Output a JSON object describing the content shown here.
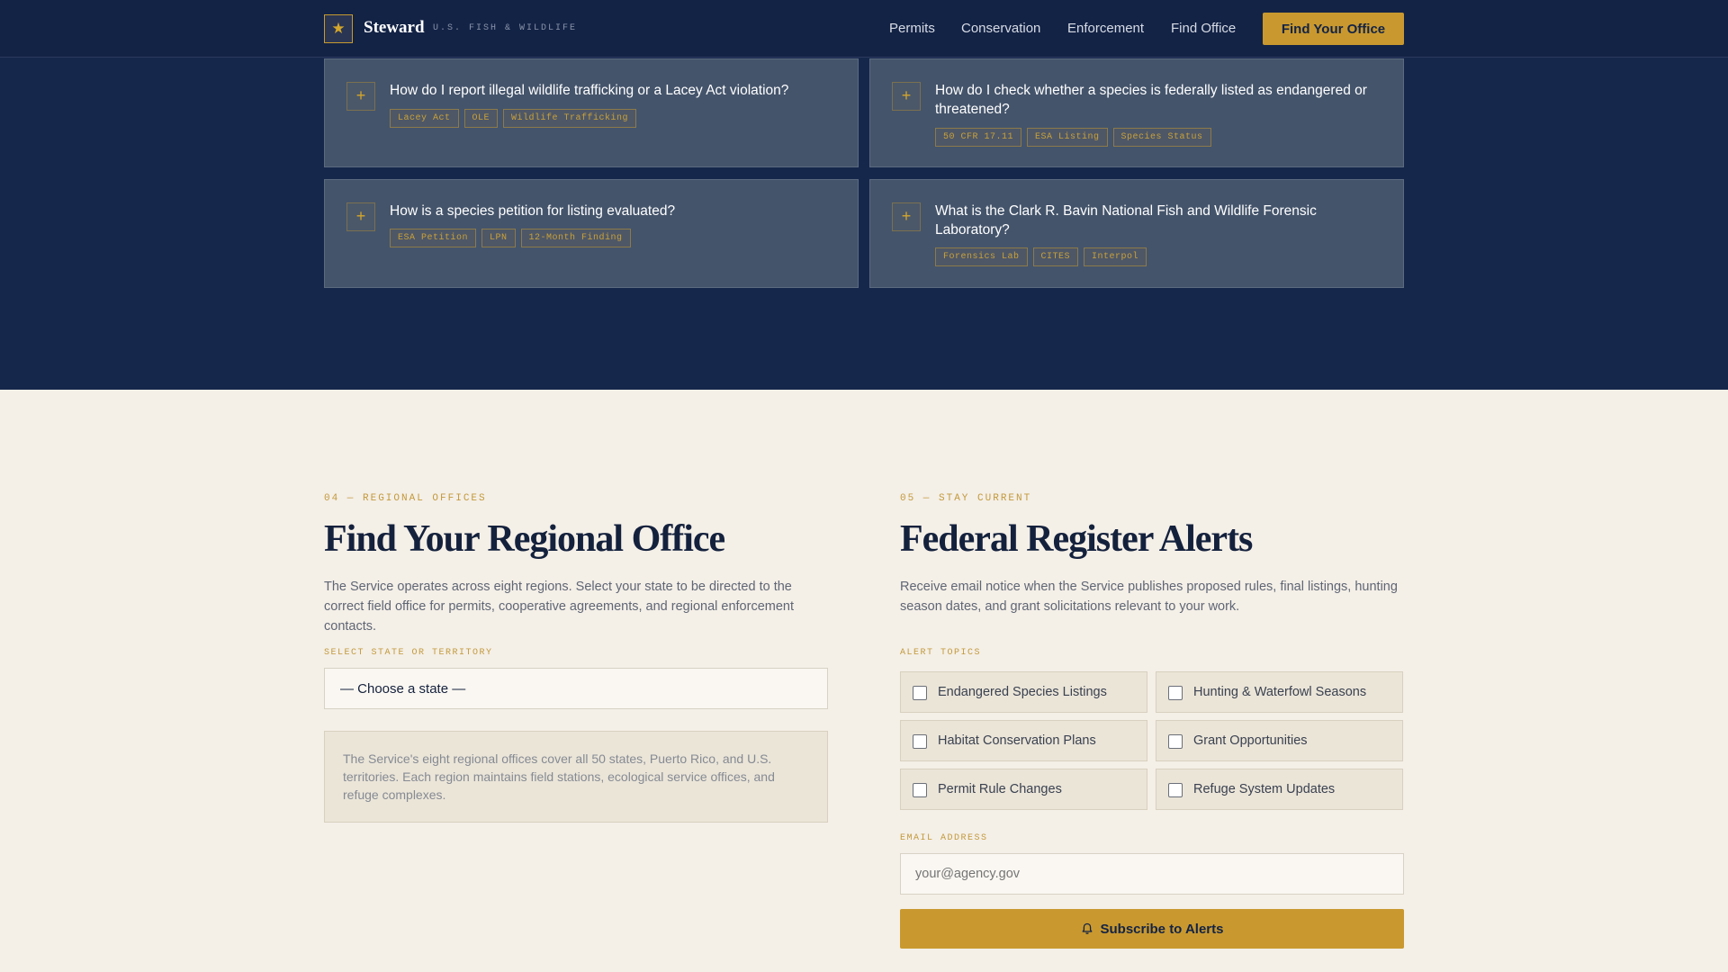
{
  "header": {
    "brand_icon": "star-icon",
    "brand_glyph": "★",
    "brand_name": "Steward",
    "brand_sub": "U.S. FISH & WILDLIFE",
    "nav": [
      "Permits",
      "Conservation",
      "Enforcement",
      "Find Office"
    ],
    "cta": "Find Your Office"
  },
  "faq": {
    "expand_glyph": "+",
    "items": [
      {
        "question": "How do I report illegal wildlife trafficking or a Lacey Act violation?",
        "tags": [
          "Lacey Act",
          "OLE",
          "Wildlife Trafficking"
        ]
      },
      {
        "question": "How do I check whether a species is federally listed as endangered or threatened?",
        "tags": [
          "50 CFR 17.11",
          "ESA Listing",
          "Species Status"
        ]
      },
      {
        "question": "How is a species petition for listing evaluated?",
        "tags": [
          "ESA Petition",
          "LPN",
          "12-Month Finding"
        ]
      },
      {
        "question": "What is the Clark R. Bavin National Fish and Wildlife Forensic Laboratory?",
        "tags": [
          "Forensics Lab",
          "CITES",
          "Interpol"
        ]
      }
    ]
  },
  "regional": {
    "eyebrow": "04 — REGIONAL OFFICES",
    "title": "Find Your Regional Office",
    "lead": "The Service operates across eight regions. Select your state to be directed to the correct field office for permits, cooperative agreements, and regional enforcement contacts.",
    "select_label": "SELECT STATE OR TERRITORY",
    "select_value": "— Choose a state —",
    "info": "The Service's eight regional offices cover all 50 states, Puerto Rico, and U.S. territories. Each region maintains field stations, ecological service offices, and refuge complexes."
  },
  "alerts": {
    "eyebrow": "05 — STAY CURRENT",
    "title": "Federal Register Alerts",
    "lead": "Receive email notice when the Service publishes proposed rules, final listings, hunting season dates, and grant solicitations relevant to your work.",
    "topics_label": "ALERT TOPICS",
    "topics": [
      "Endangered Species Listings",
      "Hunting & Waterfowl Seasons",
      "Habitat Conservation Plans",
      "Grant Opportunities",
      "Permit Rule Changes",
      "Refuge System Updates"
    ],
    "email_label": "EMAIL ADDRESS",
    "email_placeholder": "your@agency.gov",
    "subscribe_icon": "bell-icon",
    "subscribe": "Subscribe to Alerts"
  },
  "colors": {
    "navy": "#132346",
    "gold": "#c9992f",
    "cream": "#f4efe7",
    "card": "#44546b"
  }
}
